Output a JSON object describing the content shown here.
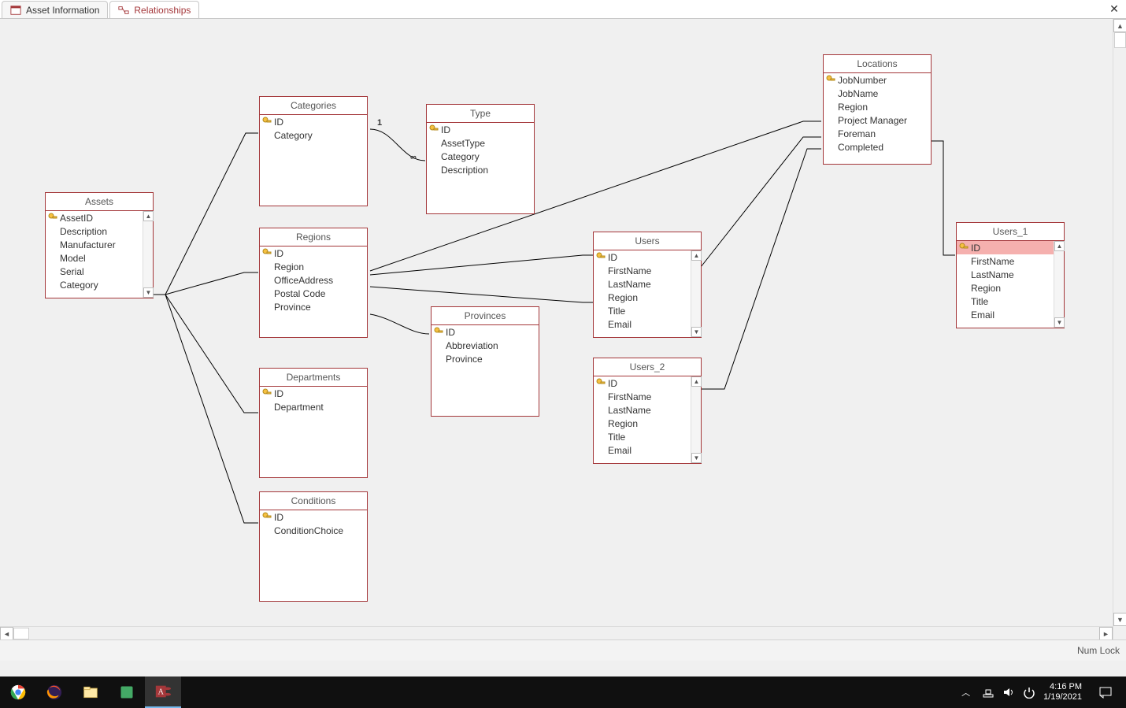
{
  "tabs": [
    {
      "label": "Asset Information",
      "icon": "form-icon",
      "active": false
    },
    {
      "label": "Relationships",
      "icon": "relationships-icon",
      "active": true
    }
  ],
  "close_label": "✕",
  "rel_one": "1",
  "rel_many": "∞",
  "tables": {
    "assets": {
      "title": "Assets",
      "fields": [
        "AssetID",
        "Description",
        "Manufacturer",
        "Model",
        "Serial",
        "Category"
      ],
      "keys": [
        0
      ]
    },
    "categories": {
      "title": "Categories",
      "fields": [
        "ID",
        "Category"
      ],
      "keys": [
        0
      ]
    },
    "type": {
      "title": "Type",
      "fields": [
        "ID",
        "AssetType",
        "Category",
        "Description"
      ],
      "keys": [
        0
      ]
    },
    "regions": {
      "title": "Regions",
      "fields": [
        "ID",
        "Region",
        "OfficeAddress",
        "Postal Code",
        "Province"
      ],
      "keys": [
        0
      ]
    },
    "departments": {
      "title": "Departments",
      "fields": [
        "ID",
        "Department"
      ],
      "keys": [
        0
      ]
    },
    "conditions": {
      "title": "Conditions",
      "fields": [
        "ID",
        "ConditionChoice"
      ],
      "keys": [
        0
      ]
    },
    "provinces": {
      "title": "Provinces",
      "fields": [
        "ID",
        "Abbreviation",
        "Province"
      ],
      "keys": [
        0
      ]
    },
    "users": {
      "title": "Users",
      "fields": [
        "ID",
        "FirstName",
        "LastName",
        "Region",
        "Title",
        "Email"
      ],
      "keys": [
        0
      ]
    },
    "users2": {
      "title": "Users_2",
      "fields": [
        "ID",
        "FirstName",
        "LastName",
        "Region",
        "Title",
        "Email"
      ],
      "keys": [
        0
      ]
    },
    "locations": {
      "title": "Locations",
      "fields": [
        "JobNumber",
        "JobName",
        "Region",
        "Project Manager",
        "Foreman",
        "Completed"
      ],
      "keys": [
        0
      ]
    },
    "users1": {
      "title": "Users_1",
      "fields": [
        "ID",
        "FirstName",
        "LastName",
        "Region",
        "Title",
        "Email"
      ],
      "keys": [
        0
      ]
    }
  },
  "statusbar": {
    "text": "Num Lock"
  },
  "taskbar": {
    "time": "4:16 PM",
    "date": "1/19/2021"
  }
}
